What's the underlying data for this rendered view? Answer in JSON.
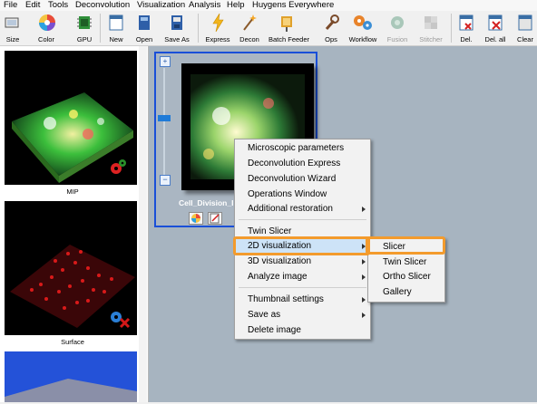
{
  "menubar": [
    "File",
    "Edit",
    "Tools",
    "Deconvolution",
    "Visualization",
    "Analysis",
    "Help",
    "Huygens Everywhere"
  ],
  "toolbar": {
    "size": "Size",
    "color": "Color",
    "gpu": "GPU",
    "new": "New",
    "open": "Open",
    "save_as": "Save As",
    "express": "Express",
    "decon": "Decon",
    "batch_feeder": "Batch Feeder",
    "ops": "Ops",
    "workflow": "Workflow",
    "fusion": "Fusion",
    "stitcher": "Stitcher",
    "del": "Del.",
    "del_all": "Del. all",
    "clear": "Clear"
  },
  "left_panel": {
    "thumbs": [
      "MIP",
      "Surface"
    ]
  },
  "image_card": {
    "name": "Cell_Division_I"
  },
  "context_menu": {
    "items": [
      "Microscopic parameters",
      "Deconvolution Express",
      "Deconvolution Wizard",
      "Operations Window",
      "Additional restoration",
      "Twin Slicer",
      "2D visualization",
      "3D visualization",
      "Analyze image",
      "Thumbnail settings",
      "Save as",
      "Delete image"
    ]
  },
  "submenu": {
    "items": [
      "Slicer",
      "Twin Slicer",
      "Ortho Slicer",
      "Gallery"
    ]
  },
  "colors": {
    "highlight_ring": "#f39b2d",
    "selection_border": "#1a4fd8",
    "workspace": "#a7b4c0"
  }
}
